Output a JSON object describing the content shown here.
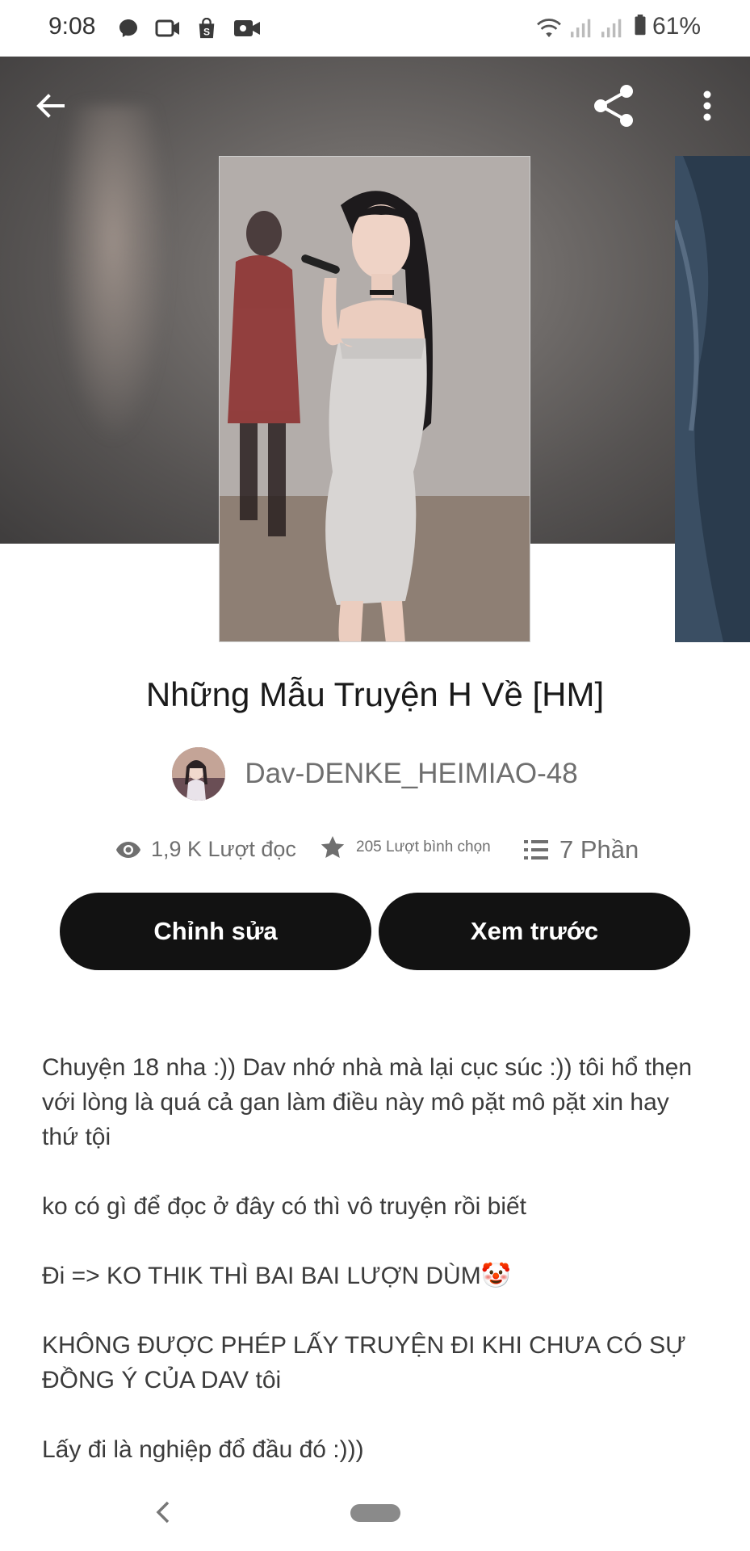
{
  "status_bar": {
    "time": "9:08",
    "battery_percent": "61%"
  },
  "header": {
    "back_icon": "arrow-left-icon",
    "share_icon": "share-icon",
    "more_icon": "more-vertical-icon"
  },
  "story": {
    "title": "Những Mẫu Truyện H Về [HM]",
    "author": "Dav-DENKE_HEIMIAO-48",
    "stats": {
      "reads": "1,9 K Lượt đọc",
      "votes": "205 Lượt bình chọn",
      "parts": "7 Phần"
    },
    "buttons": {
      "edit": "Chỉnh sửa",
      "preview": "Xem trước"
    },
    "description": [
      "Chuyện 18 nha :)) Dav nhớ nhà mà lại cục súc :)) tôi hổ thẹn với lòng là quá cả gan làm điều này mô pặt mô pặt xin hay thứ tội",
      "ko có gì để đọc ở đây có thì vô truyện rồi biết",
      "Đi => KO THIK THÌ BAI BAI LƯỢN DÙM🤡",
      "KHÔNG ĐƯỢC PHÉP LẤY TRUYỆN ĐI KHI CHƯA CÓ SỰ ĐỒNG Ý CỦA DAV tôi",
      "Lấy đi là nghiệp đổ đầu đó :)))"
    ]
  },
  "colors": {
    "button_bg": "#121212",
    "button_text": "#ffffff",
    "muted_text": "#6f6f6f"
  }
}
